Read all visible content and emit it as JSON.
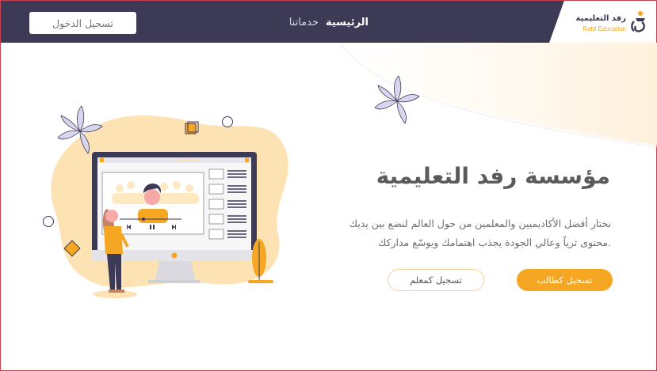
{
  "navbar": {
    "logo": {
      "arabic": "رفد التعليمية",
      "english": "Rafd Education"
    },
    "links": [
      {
        "label": "الرئيسية",
        "active": true
      },
      {
        "label": "خدماتنا",
        "active": false
      }
    ],
    "login_label": "تسجيل الدخول"
  },
  "hero": {
    "title": "مؤسسة رفد التعليمية",
    "description_line1": "نختار أفضل الأكاديميين والمعلمين من حول العالم  لنضع بين يديك",
    "description_line2": ".محتوى ثرياً وعالي الجودة يجذب اهتمامك ويوسّع مداركك",
    "student_button": "تسجيل كطالب",
    "teacher_button": "تسجيل كمعلم"
  },
  "colors": {
    "navbar_bg": "#3d3a56",
    "accent": "#f5a623",
    "title_text": "#5b5b5b",
    "blob": "#fde3b3"
  },
  "icons": [
    "logo-mark-icon",
    "flower-icon",
    "play-icon",
    "pause-icon"
  ]
}
